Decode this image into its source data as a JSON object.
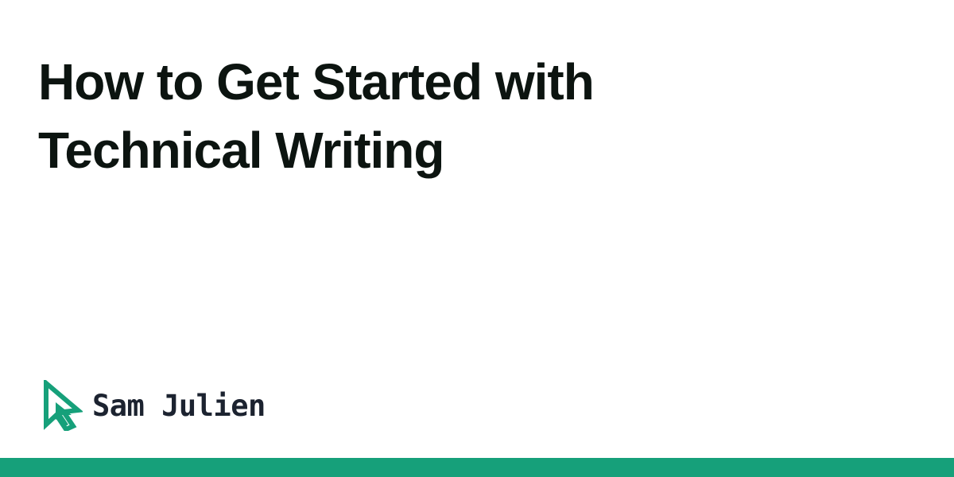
{
  "title_lines": [
    "How to Get Started with",
    "Technical Writing"
  ],
  "brand": {
    "name": "Sam Julien",
    "icon": "cursor-arrow-icon"
  },
  "colors": {
    "background": "#ffffff",
    "title": "#0c1410",
    "brand_text": "#1c2330",
    "accent": "#16a07a"
  }
}
